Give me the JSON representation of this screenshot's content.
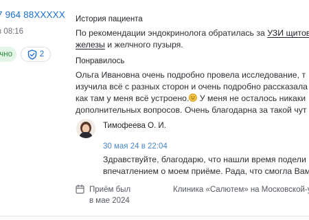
{
  "sidebar": {
    "phone": "7 964 88XXXXX",
    "time": "в 08:16",
    "green_tag": "чно",
    "shield_count": "2"
  },
  "review": {
    "history_title": "История пациента",
    "history_text_1": "По рекомендации эндокринолога обратилась за ",
    "history_link_1": "УЗИ щитов",
    "history_link_2": "железы",
    "history_text_2": " и желчного пузыря.",
    "liked_title": "Понравилось",
    "liked_line_1": "Ольга Ивановна очень подробно провела исследование, т",
    "liked_line_2": "изучила всё с разных сторон и очень подробно рассказала",
    "liked_line_3": "как там у меня всё устроено.",
    "liked_line_3b": " У меня не осталось никаки",
    "liked_line_4": "дополнительных вопросов. Очень благодарна за такой чут"
  },
  "reply": {
    "author": "Тимофеева О. И.",
    "date": "30 мая 24 в 22:04",
    "line_1": "Здравствуйте, благодарю, что нашли время подели",
    "line_2": "впечатлением о моем приёме. Рада, что смогла Вам"
  },
  "footer": {
    "visit_line_1": "Приём был",
    "visit_line_2": "в мае 2024",
    "clinic": "Клиника «Салютем» на Московской-ул"
  },
  "colors": {
    "accent": "#1a6fd4",
    "date_blue": "#4a86c8",
    "green_tag_bg": "#e3f5e6",
    "green_tag_text": "#2d8a3e"
  },
  "icons": {
    "shield": "shield-check-icon",
    "calendar": "calendar-icon",
    "emoji": "smiling-face-emoji"
  }
}
